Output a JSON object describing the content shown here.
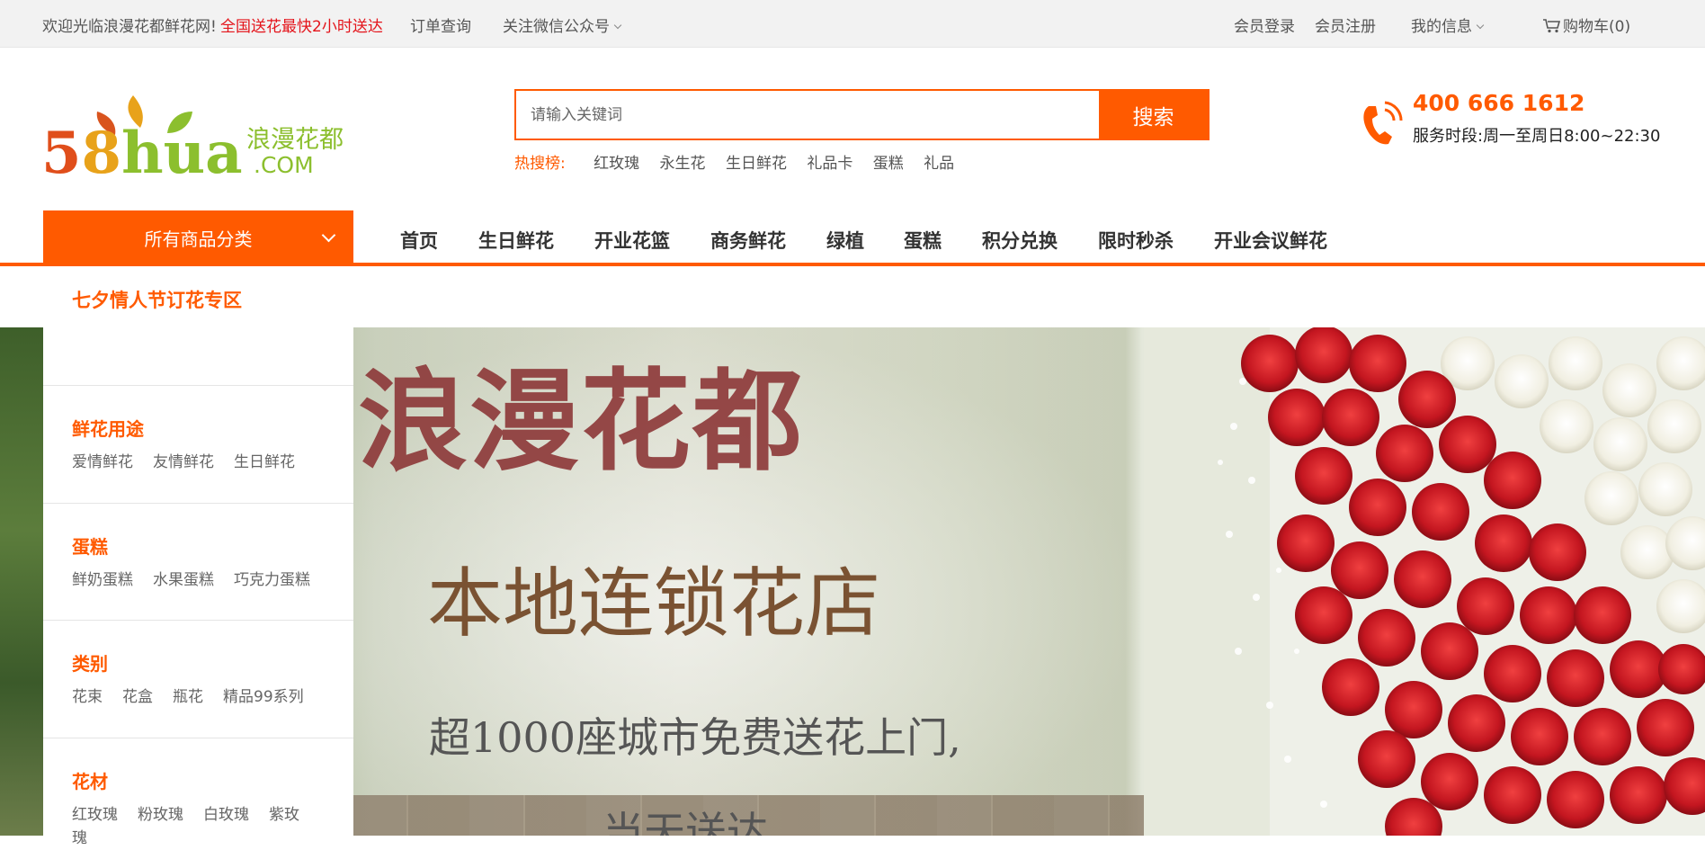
{
  "topbar": {
    "welcome": "欢迎光临浪漫花都鲜花网!",
    "promo": "全国送花最快2小时送达",
    "order_query": "订单查询",
    "wechat": "关注微信公众号",
    "login": "会员登录",
    "register": "会员注册",
    "my_info": "我的信息",
    "cart": "购物车(0)"
  },
  "search": {
    "placeholder": "请输入关键词",
    "button": "搜索",
    "hot_label": "热搜榜:",
    "hot_terms": [
      "红玫瑰",
      "永生花",
      "生日鲜花",
      "礼品卡",
      "蛋糕",
      "礼品"
    ]
  },
  "contact": {
    "phone": "400 666 1612",
    "hours": "服务时段:周一至周日8:00~22:30"
  },
  "nav": {
    "all_categories": "所有商品分类",
    "items": [
      "首页",
      "生日鲜花",
      "开业花篮",
      "商务鲜花",
      "绿植",
      "蛋糕",
      "积分兑换",
      "限时秒杀",
      "开业会议鲜花"
    ]
  },
  "promo_link": "七夕情人节订花专区",
  "sidebar": {
    "groups": [
      {
        "title": "鲜花用途",
        "links": [
          "爱情鲜花",
          "友情鲜花",
          "生日鲜花"
        ]
      },
      {
        "title": "蛋糕",
        "links": [
          "鲜奶蛋糕",
          "水果蛋糕",
          "巧克力蛋糕"
        ]
      },
      {
        "title": "类别",
        "links": [
          "花束",
          "花盒",
          "瓶花",
          "精品99系列"
        ]
      },
      {
        "title": "花材",
        "links": [
          "红玫瑰",
          "粉玫瑰",
          "白玫瑰",
          "紫玫瑰"
        ]
      }
    ]
  },
  "banner": {
    "title": "浪漫花都",
    "subtitle": "本地连锁花店",
    "line1": "超1000座城市免费送花上门,",
    "line2": "当天送达"
  },
  "logo": {
    "main": "58hua",
    "cn": "浪漫花都",
    "com": ".COM"
  },
  "colors": {
    "accent": "#ff5a00",
    "promo_red": "#e4141b"
  },
  "icons": {
    "cart": "cart-icon",
    "phone": "phone-icon",
    "chevron": "chevron-down-icon"
  }
}
